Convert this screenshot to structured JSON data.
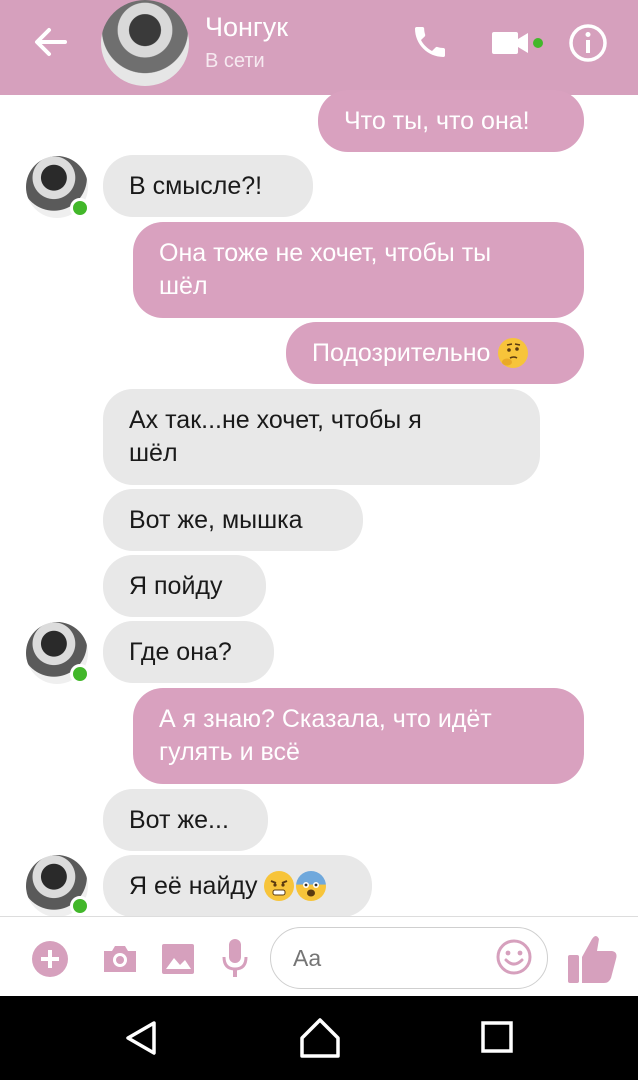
{
  "header": {
    "contact_name": "Чонгук",
    "status": "В сети",
    "icons": [
      "back-arrow-icon",
      "phone-icon",
      "video-camera-icon",
      "info-icon"
    ],
    "accent_color": "#d6a0bd",
    "online_color": "#42b72a"
  },
  "messages": [
    {
      "side": "out",
      "text": "Что ты, что она!"
    },
    {
      "side": "in",
      "text": "В смысле?!"
    },
    {
      "side": "out",
      "line1": "Она тоже не хочет, чтобы ты",
      "line2": "шёл"
    },
    {
      "side": "out",
      "text": "Подозрительно",
      "emoji": "thinking-face-emoji"
    },
    {
      "side": "in",
      "line1": "Ах так...не хочет, чтобы я",
      "line2": "шёл"
    },
    {
      "side": "in",
      "text": "Вот же, мышка"
    },
    {
      "side": "in",
      "text": "Я пойду"
    },
    {
      "side": "in",
      "text": "Где она?"
    },
    {
      "side": "out",
      "line1": "А я знаю? Сказала, что идёт",
      "line2": "гулять и всё"
    },
    {
      "side": "in",
      "text": "Вот же..."
    },
    {
      "side": "in",
      "text": "Я её найду",
      "emoji": [
        "angry-face-emoji",
        "fearful-face-emoji"
      ]
    }
  ],
  "composer": {
    "placeholder": "Aa",
    "icons": [
      "plus-icon",
      "camera-icon",
      "image-icon",
      "microphone-icon",
      "smiley-icon",
      "thumbs-up-icon"
    ]
  },
  "navbar": {
    "icons": [
      "nav-back-icon",
      "nav-home-icon",
      "nav-recents-icon"
    ]
  }
}
